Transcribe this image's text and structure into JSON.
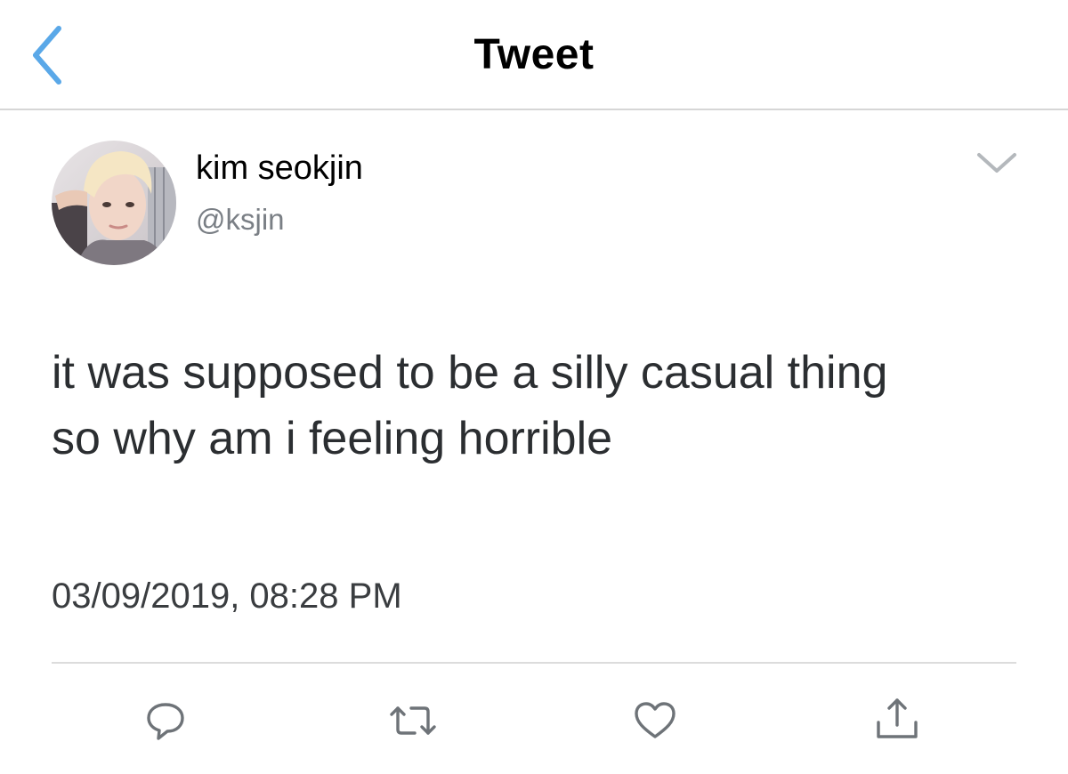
{
  "navbar": {
    "title": "Tweet",
    "back_icon": "chevron-left-icon",
    "accent_color": "#5aa8e8"
  },
  "tweet": {
    "author": {
      "display_name": "kim seokjin",
      "handle": "@ksjin",
      "avatar": "avatar-photo"
    },
    "more_icon": "chevron-down-icon",
    "text_lines": [
      "it was supposed to be a silly casual thing",
      "so why am i feeling horrible"
    ],
    "timestamp": "03/09/2019, 08:28 PM"
  },
  "actions": [
    {
      "name": "reply",
      "icon": "reply-icon"
    },
    {
      "name": "retweet",
      "icon": "retweet-icon"
    },
    {
      "name": "like",
      "icon": "heart-icon"
    },
    {
      "name": "share",
      "icon": "share-icon"
    }
  ],
  "colors": {
    "icon_gray": "#6e7378",
    "text_gray": "#7a7f85",
    "divider": "#dcdcdc"
  }
}
